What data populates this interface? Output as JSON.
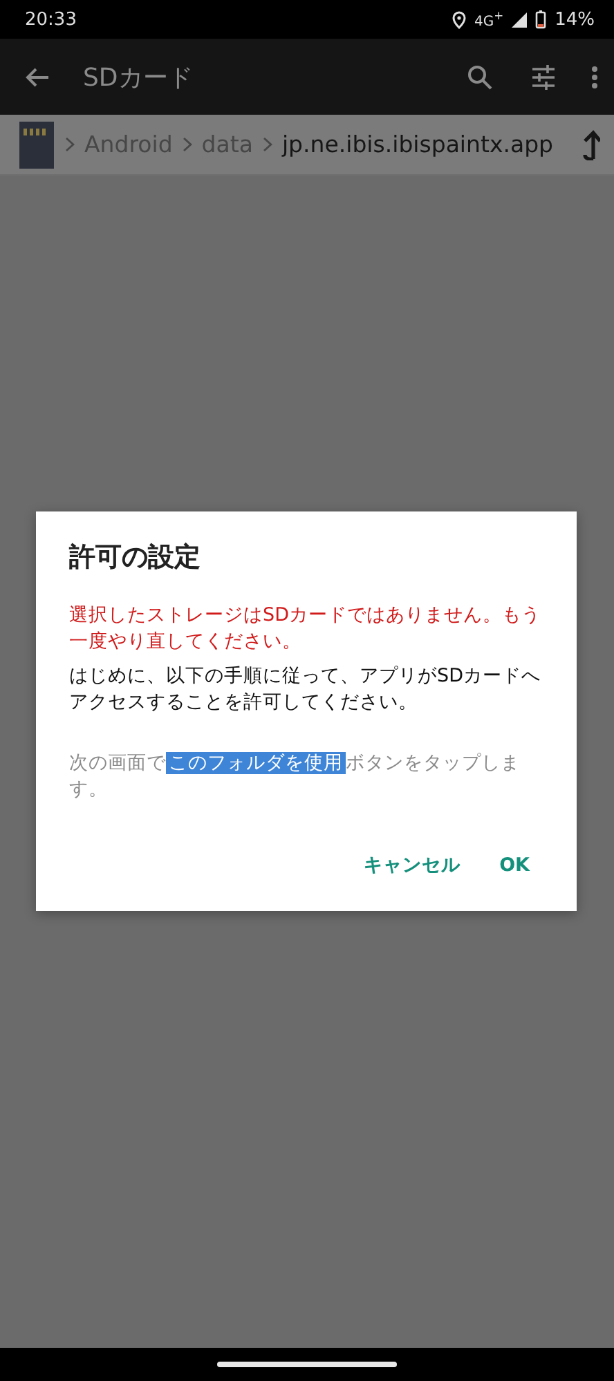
{
  "status_bar": {
    "time": "20:33",
    "network": "4G$^{+}$",
    "battery": "14%"
  },
  "app_bar": {
    "title": "SDカード"
  },
  "path": {
    "segments": [
      {
        "label": "Android",
        "current": false
      },
      {
        "label": "data",
        "current": false
      },
      {
        "label": "jp.ne.ibis.ibispaintx.app",
        "current": true
      }
    ]
  },
  "dialog": {
    "title": "許可の設定",
    "error": "選択したストレージはSDカードではありません。もう一度やり直してください。",
    "message": "はじめに、以下の手順に従って、アプリがSDカードへアクセスすることを許可してください。",
    "instruction": {
      "before": "次の画面で",
      "highlight": "このフォルダを使用",
      "after": "ボタンをタップします。"
    },
    "buttons": [
      "キャンセル",
      "OK"
    ]
  }
}
